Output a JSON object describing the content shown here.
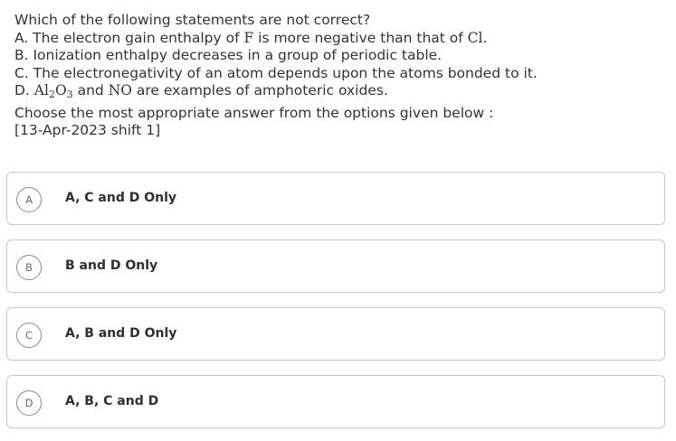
{
  "question": {
    "intro": "Which of the following statements are not correct?",
    "statement_a": {
      "prefix": "A. The electron gain enthalpy of ",
      "symbol_1": "F",
      "middle": " is more negative than that of ",
      "symbol_2": "Cl",
      "suffix": "."
    },
    "statement_b": "B. Ionization enthalpy decreases in a group of periodic table.",
    "statement_c": "C. The electronegativity of an atom depends upon the atoms bonded to it.",
    "statement_d": {
      "prefix": "D. ",
      "al": "Al",
      "sub_2": "2",
      "o": "O",
      "sub_3": "3",
      "and": " and ",
      "no": "NO",
      "suffix": " are examples of amphoteric oxides."
    },
    "prompt": "Choose the most appropriate answer from the options given below :",
    "source": "[13-Apr-2023 shift 1]"
  },
  "options": [
    {
      "letter": "A",
      "text": "A, C and D Only"
    },
    {
      "letter": "B",
      "text": "B and D Only"
    },
    {
      "letter": "C",
      "text": "A, B and D Only"
    },
    {
      "letter": "D",
      "text": "A, B, C and D"
    }
  ],
  "colors": {
    "text": "#333333",
    "border": "#c8c8c8",
    "badge_border": "#8a8a8a"
  }
}
